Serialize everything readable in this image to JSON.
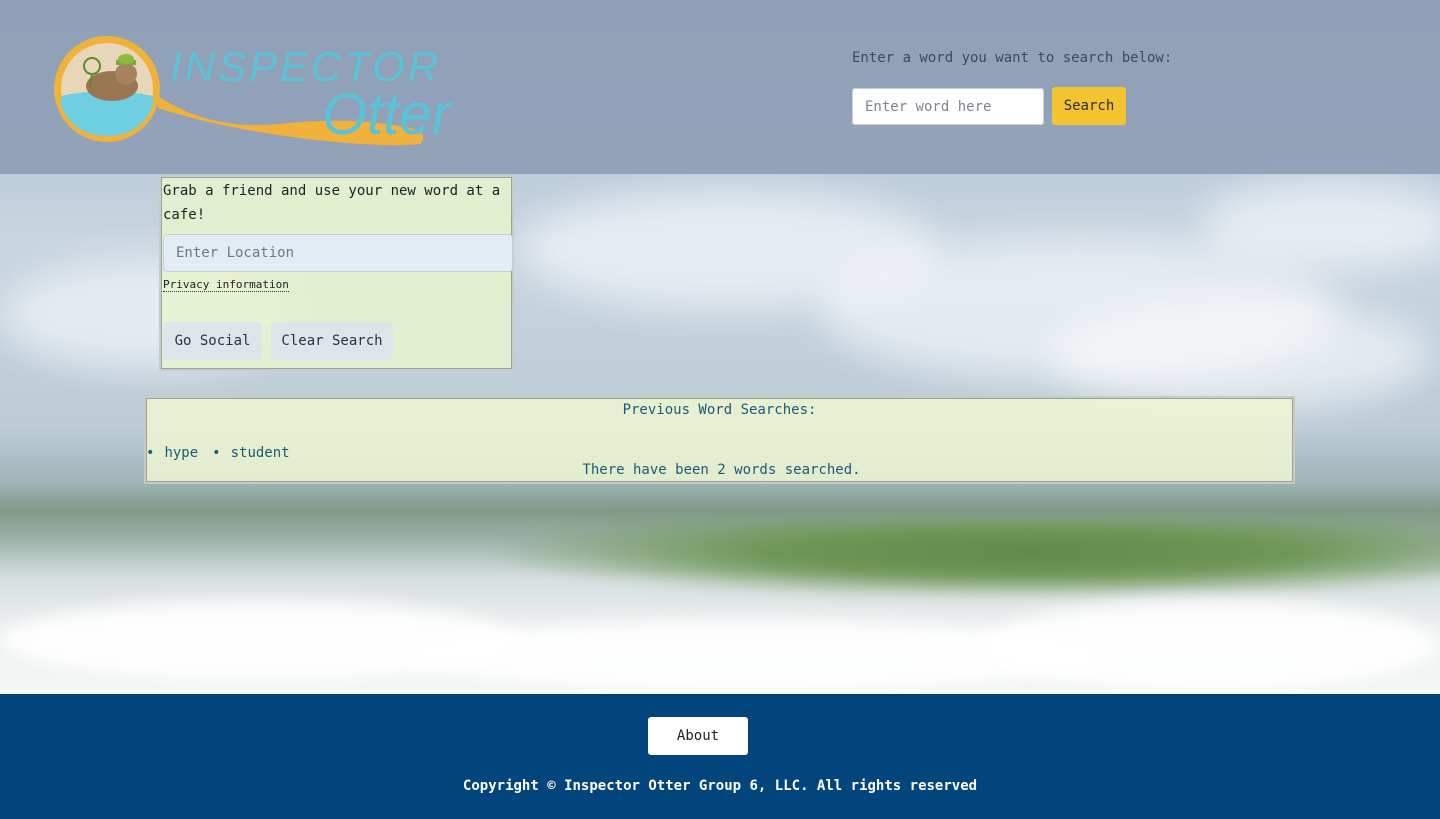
{
  "header": {
    "logo_text_line1": "INSPECTOR",
    "logo_text_line2": "Otter",
    "search_prompt": "Enter a word you want to search below:",
    "search_placeholder": "Enter word here",
    "search_button_label": "Search"
  },
  "social": {
    "text": "Grab a friend and use your new word at a cafe!",
    "location_placeholder": "Enter Location",
    "privacy_link": "Privacy information",
    "go_social_label": "Go Social",
    "clear_search_label": "Clear Search"
  },
  "history": {
    "title": "Previous Word Searches:",
    "words": [
      "hype",
      "student"
    ],
    "count_text": "There have been 2 words searched."
  },
  "footer": {
    "about_label": "About",
    "copyright": "Copyright © Inspector Otter Group 6, LLC. All rights reserved"
  },
  "colors": {
    "accent_yellow": "#f4c430",
    "footer_blue": "#02457d",
    "logo_teal": "#5bc3d8",
    "logo_gold": "#f0b23a"
  }
}
